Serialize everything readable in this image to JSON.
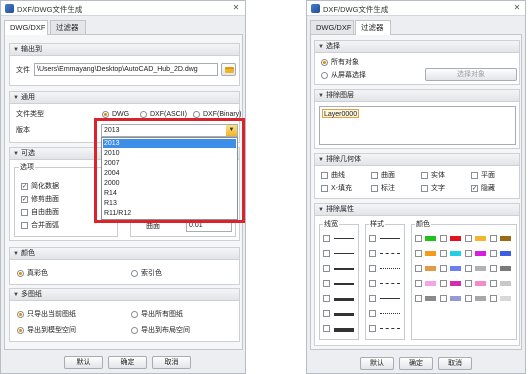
{
  "left": {
    "title": "DXF/DWG文件生成",
    "close_glyph": "✕",
    "tabs": [
      "DWG/DXF",
      "过滤器"
    ],
    "output": {
      "header": "输出到",
      "file_label": "文件",
      "file_path": "\\Users\\Emmayang\\Desktop\\AutoCAD_Hub_2D.dwg"
    },
    "general": {
      "header": "通用",
      "file_type_label": "文件类型",
      "types": [
        "DWG",
        "DXF(ASCII)",
        "DXF(Binary)"
      ],
      "selected_type": "DWG",
      "version_label": "版本",
      "version": "2013",
      "version_options": [
        "2013",
        "2010",
        "2007",
        "2004",
        "2000",
        "R14",
        "R13",
        "R11/R12"
      ],
      "highlighted_option": "2013"
    },
    "optional": {
      "header": "可选",
      "options_group": "选项",
      "options": [
        "简化数据",
        "修剪曲面",
        "自由曲面",
        "合并面弧"
      ],
      "options_checked": [
        true,
        true,
        false,
        false
      ],
      "surface_label": "曲面",
      "surface_value": "0.01"
    },
    "color": {
      "header": "颜色",
      "true_color": "真彩色",
      "index_color": "索引色",
      "selected": "真彩色"
    },
    "multi": {
      "header": "多图纸",
      "export_current": "只导出当前图纸",
      "export_all": "导出所有图纸",
      "to_model": "导出到模型空间",
      "to_layout": "导出到布局空间",
      "selected_sheet": "只导出当前图纸",
      "selected_space": "导出到模型空间"
    },
    "buttons": {
      "default": "默认",
      "ok": "确定",
      "cancel": "取消"
    }
  },
  "right": {
    "title": "DXF/DWG文件生成",
    "close_glyph": "✕",
    "tabs": [
      "DWG/DXF",
      "过滤器"
    ],
    "select": {
      "header": "选择",
      "all": "所有对象",
      "from_screen": "从屏幕选择",
      "select_button": "选择对象",
      "selected": "所有对象"
    },
    "layers": {
      "header": "排除图层",
      "items": [
        "Layer0000"
      ]
    },
    "geometry": {
      "header": "排除几何体",
      "items": [
        "曲线",
        "曲面",
        "实体",
        "平面",
        "X-填充",
        "标注",
        "文字",
        "隐藏"
      ],
      "checked": [
        false,
        false,
        false,
        false,
        false,
        false,
        false,
        true
      ]
    },
    "attrs": {
      "header": "排除属性",
      "linewidth_label": "线宽",
      "style_label": "样式",
      "color_label": "颜色",
      "colors": [
        "#22c11a",
        "#e2141c",
        "#f3b62a",
        "#9a6a1a",
        "#f59a1a",
        "#22cfe6",
        "#d61ee0",
        "#3a5fe6",
        "#e09a4a",
        "#6a80ee",
        "#b2b2b2",
        "#7a7a7a",
        "#f4a4e8",
        "#d42cb0",
        "#f48ac8",
        "#c8c8c8",
        "#8a8a8a",
        "#9898d8",
        "#a8a8a8",
        "#d8d8d8"
      ]
    },
    "buttons": {
      "default": "默认",
      "ok": "确定",
      "cancel": "取消"
    }
  }
}
